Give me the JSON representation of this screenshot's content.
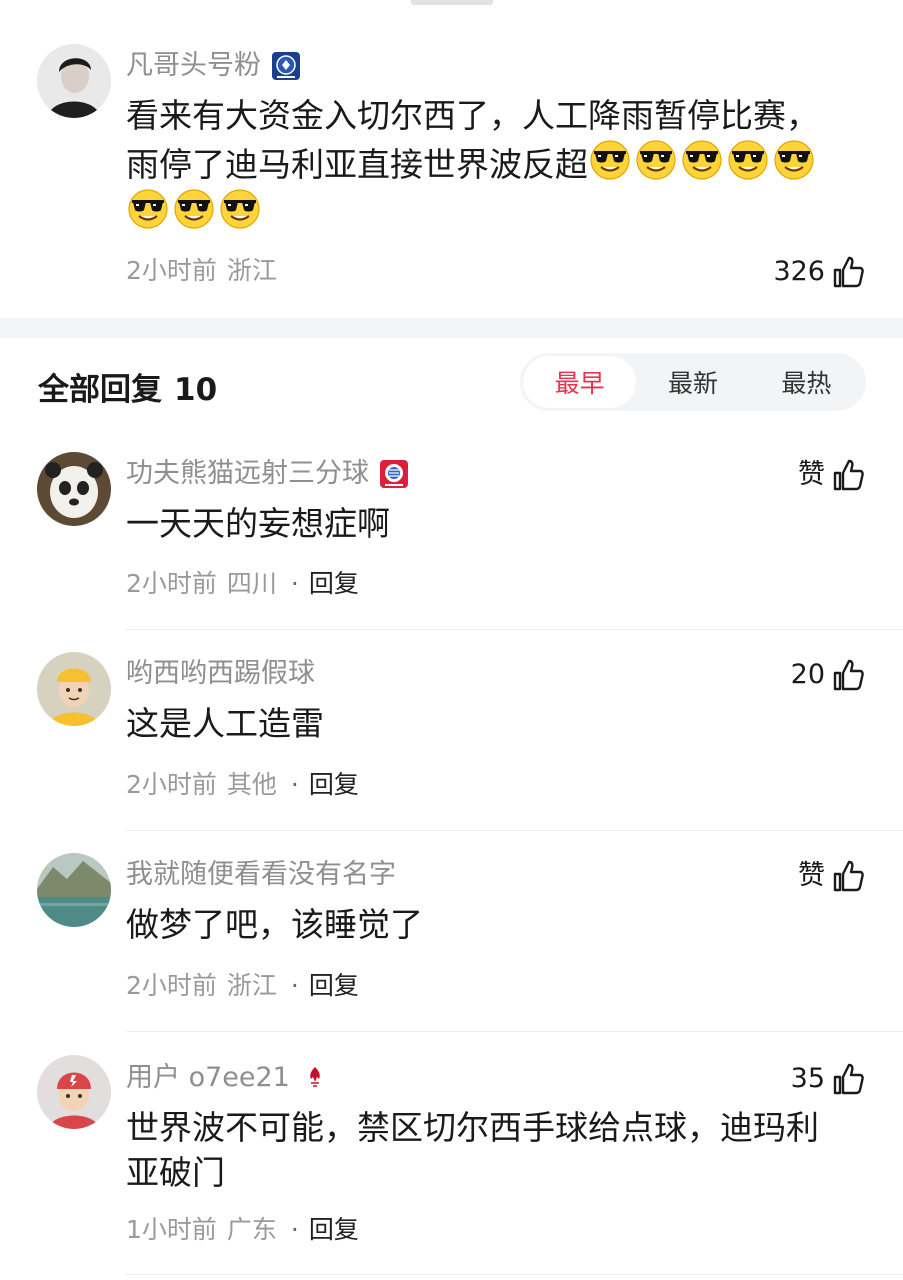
{
  "main_comment": {
    "username": "凡哥头号粉",
    "badge": "chelsea-badge-icon",
    "line1": "看来有大资金入切尔西了，人工降雨暂停比赛，",
    "line2": "雨停了迪马利亚直接世界波反超",
    "emoji": "sunglasses-emoji-icon",
    "emoji_count": 8,
    "time": "2小时前",
    "location": "浙江",
    "likes": "326"
  },
  "replies_header": {
    "title": "全部回复",
    "count": "10",
    "sort_tabs": [
      "最早",
      "最新",
      "最热"
    ],
    "active_tab": "最早"
  },
  "replies": [
    {
      "username": "功夫熊猫远射三分球",
      "badge": "bayern-badge-icon",
      "content": "一天天的妄想症啊",
      "time": "2小时前",
      "location": "四川",
      "reply_label": "回复",
      "likes": "赞"
    },
    {
      "username": "哟西哟西踢假球",
      "badge": "",
      "content": "这是人工造雷",
      "time": "2小时前",
      "location": "其他",
      "reply_label": "回复",
      "likes": "20"
    },
    {
      "username": "我就随便看看没有名字",
      "badge": "",
      "content": "做梦了吧，该睡觉了",
      "time": "2小时前",
      "location": "浙江",
      "reply_label": "回复",
      "likes": "赞"
    },
    {
      "username": "用户 o7ee21",
      "badge": "liverpool-badge-icon",
      "content_line1": "世界波不可能，禁区切尔西手球给点球，迪玛利",
      "content_line2": "亚破门",
      "time": "1小时前",
      "location": "广东",
      "reply_label": "回复",
      "likes": "35"
    }
  ],
  "colors": {
    "accent": "#e8344b",
    "username": "#8f8f8f",
    "meta": "#9a9a9a",
    "section_gap": "#f4f5f7"
  }
}
